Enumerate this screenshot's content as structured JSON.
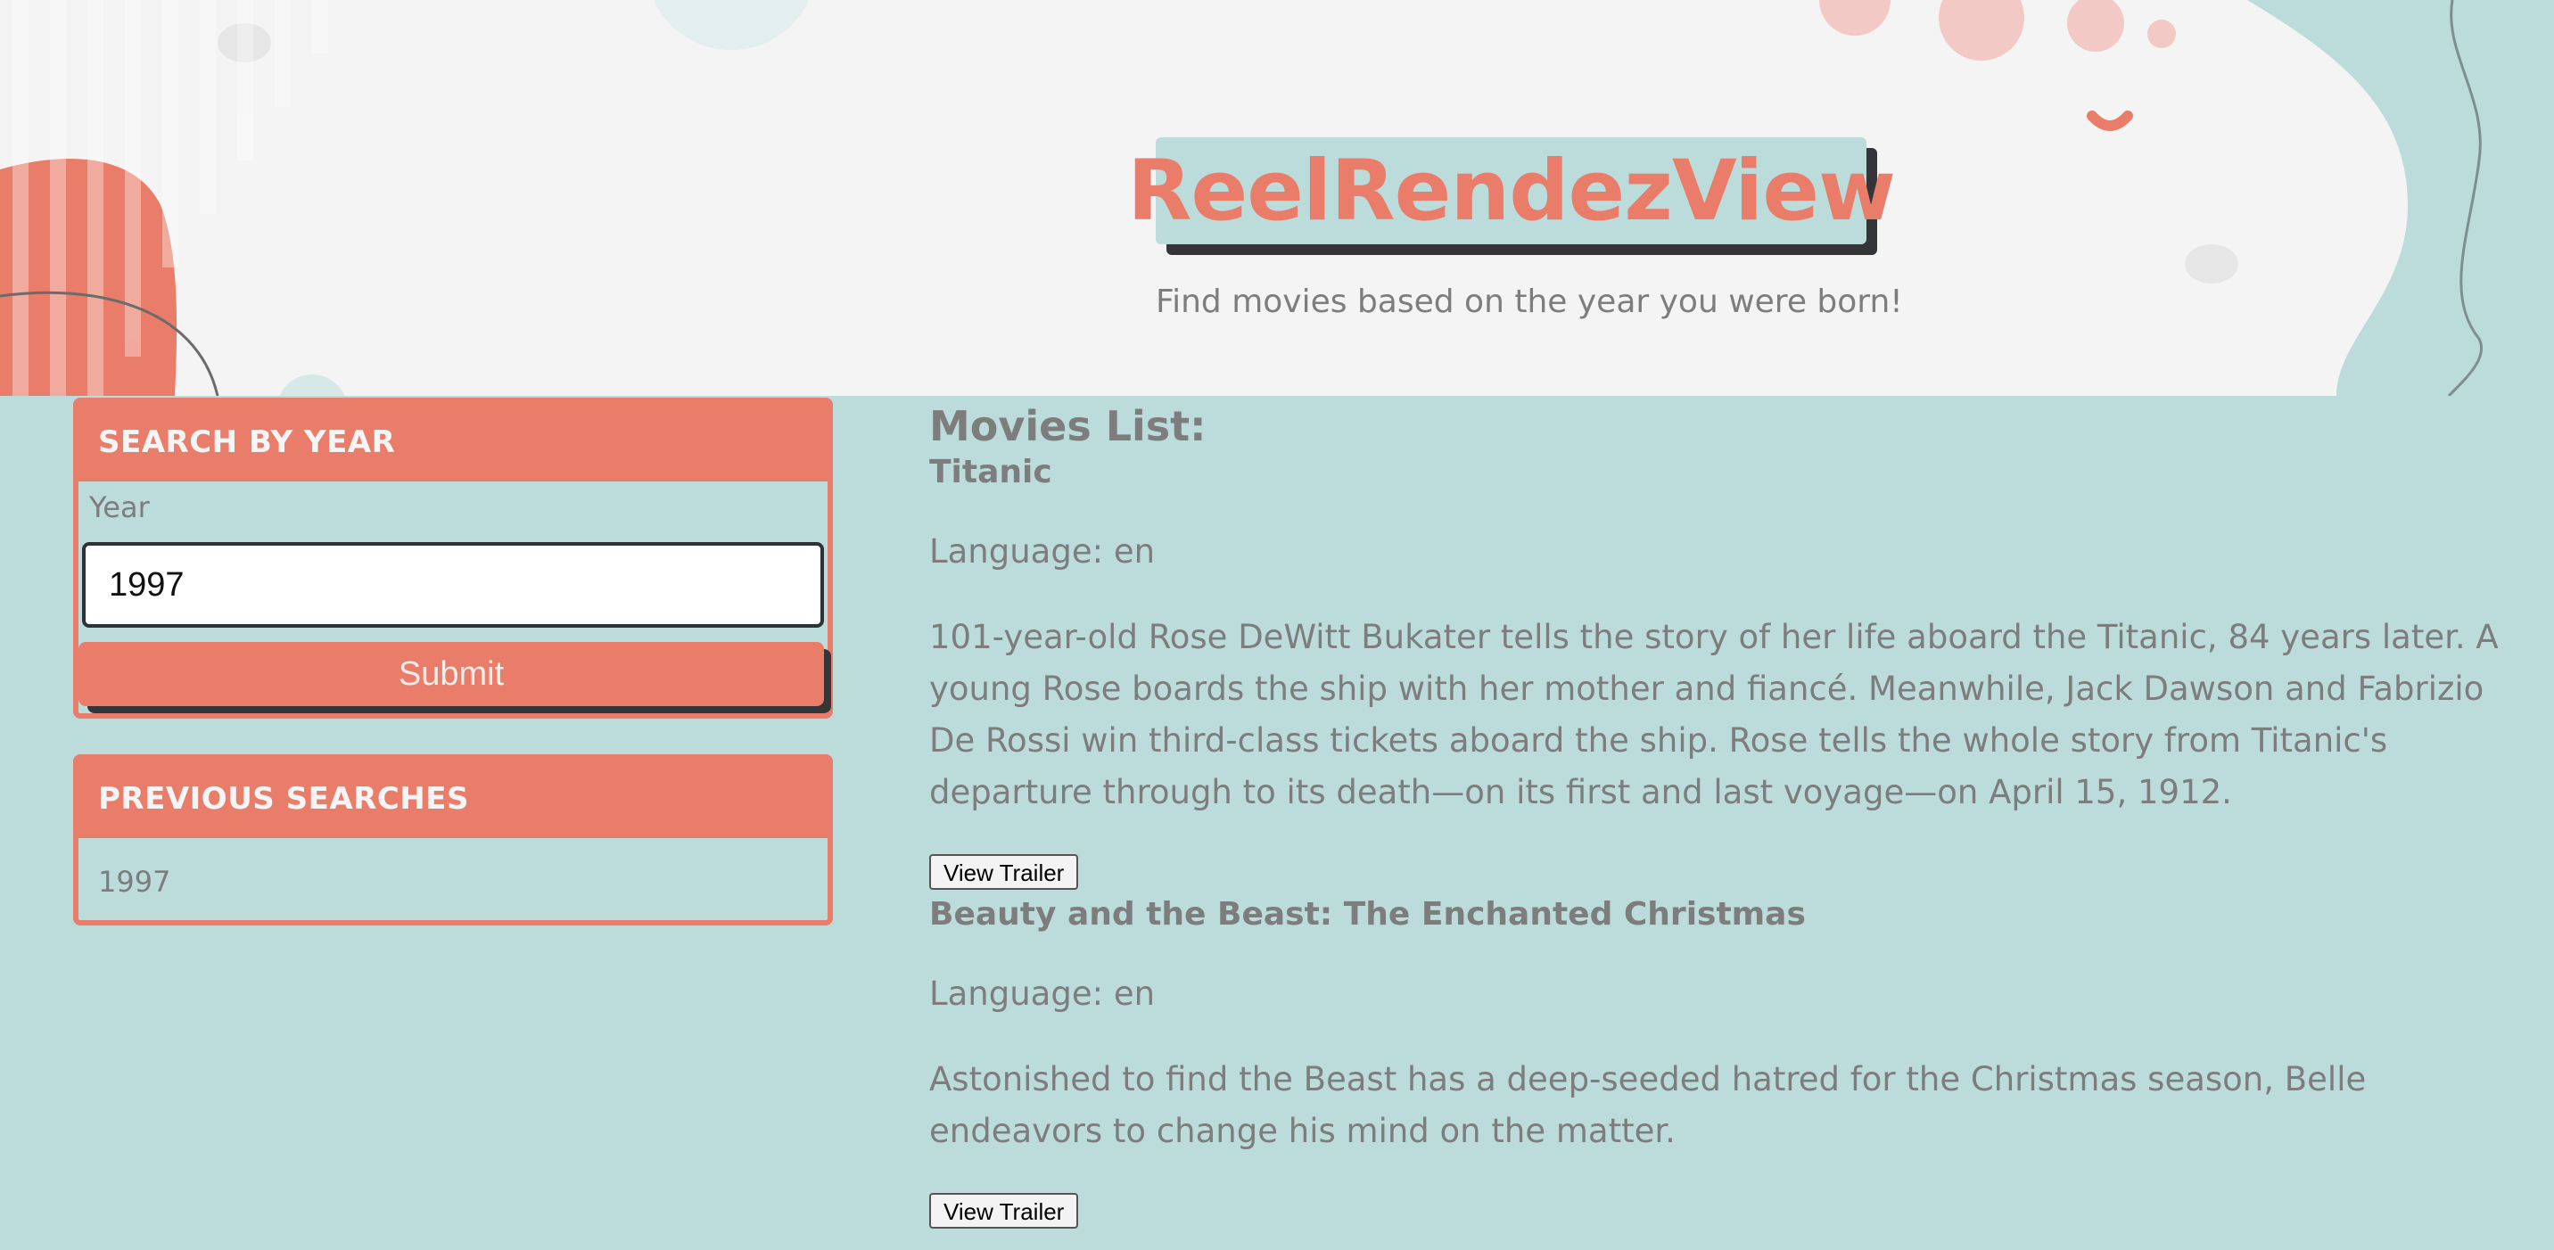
{
  "header": {
    "title": "ReelRendezView",
    "tagline": "Find movies based on the year you were born!"
  },
  "search": {
    "heading": "SEARCH BY YEAR",
    "year_label": "Year",
    "year_value": "1997",
    "submit_label": "Submit"
  },
  "previous": {
    "heading": "PREVIOUS SEARCHES",
    "items": [
      "1997"
    ]
  },
  "movies": {
    "heading": "Movies List:",
    "items": [
      {
        "title": "Titanic",
        "language": "Language: en",
        "overview": "101-year-old Rose DeWitt Bukater tells the story of her life aboard the Titanic, 84 years later. A young Rose boards the ship with her mother and fiancé. Meanwhile, Jack Dawson and Fabrizio De Rossi win third-class tickets aboard the ship. Rose tells the whole story from Titanic's departure through to its death—on its first and last voyage—on April 15, 1912.",
        "trailer_label": "View Trailer"
      },
      {
        "title": "Beauty and the Beast: The Enchanted Christmas",
        "language": "Language: en",
        "overview": "Astonished to find the Beast has a deep-seeded hatred for the Christmas season, Belle endeavors to change his mind on the matter.",
        "trailer_label": "View Trailer"
      }
    ]
  },
  "colors": {
    "coral": "#ea7c6a",
    "teal_bg": "#bcdcdc",
    "hero_bg": "#f4f4f4",
    "text_gray": "#7d7d7d",
    "dark_shadow": "#333539"
  }
}
